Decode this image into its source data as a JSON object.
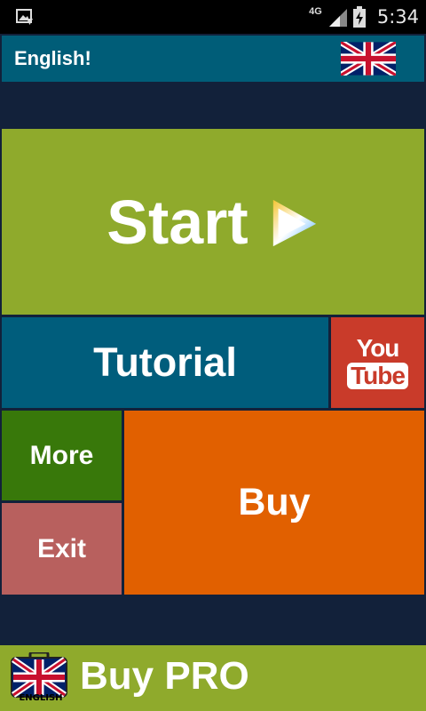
{
  "status_bar": {
    "network": "4G",
    "time": "5:34"
  },
  "header": {
    "title": "English!",
    "flag_icon": "uk-flag-icon"
  },
  "tiles": {
    "start": "Start",
    "tutorial": "Tutorial",
    "youtube_top": "You",
    "youtube_bottom": "Tube",
    "more": "More",
    "exit": "Exit",
    "buy": "Buy"
  },
  "bottom": {
    "label": "Buy PRO",
    "badge": "ENGLISH"
  },
  "colors": {
    "background": "#12213a",
    "header": "#005d78",
    "start": "#8faa2c",
    "tutorial": "#005d7c",
    "youtube": "#c93b2a",
    "more": "#38780a",
    "exit": "#b8605e",
    "buy": "#e16000"
  }
}
